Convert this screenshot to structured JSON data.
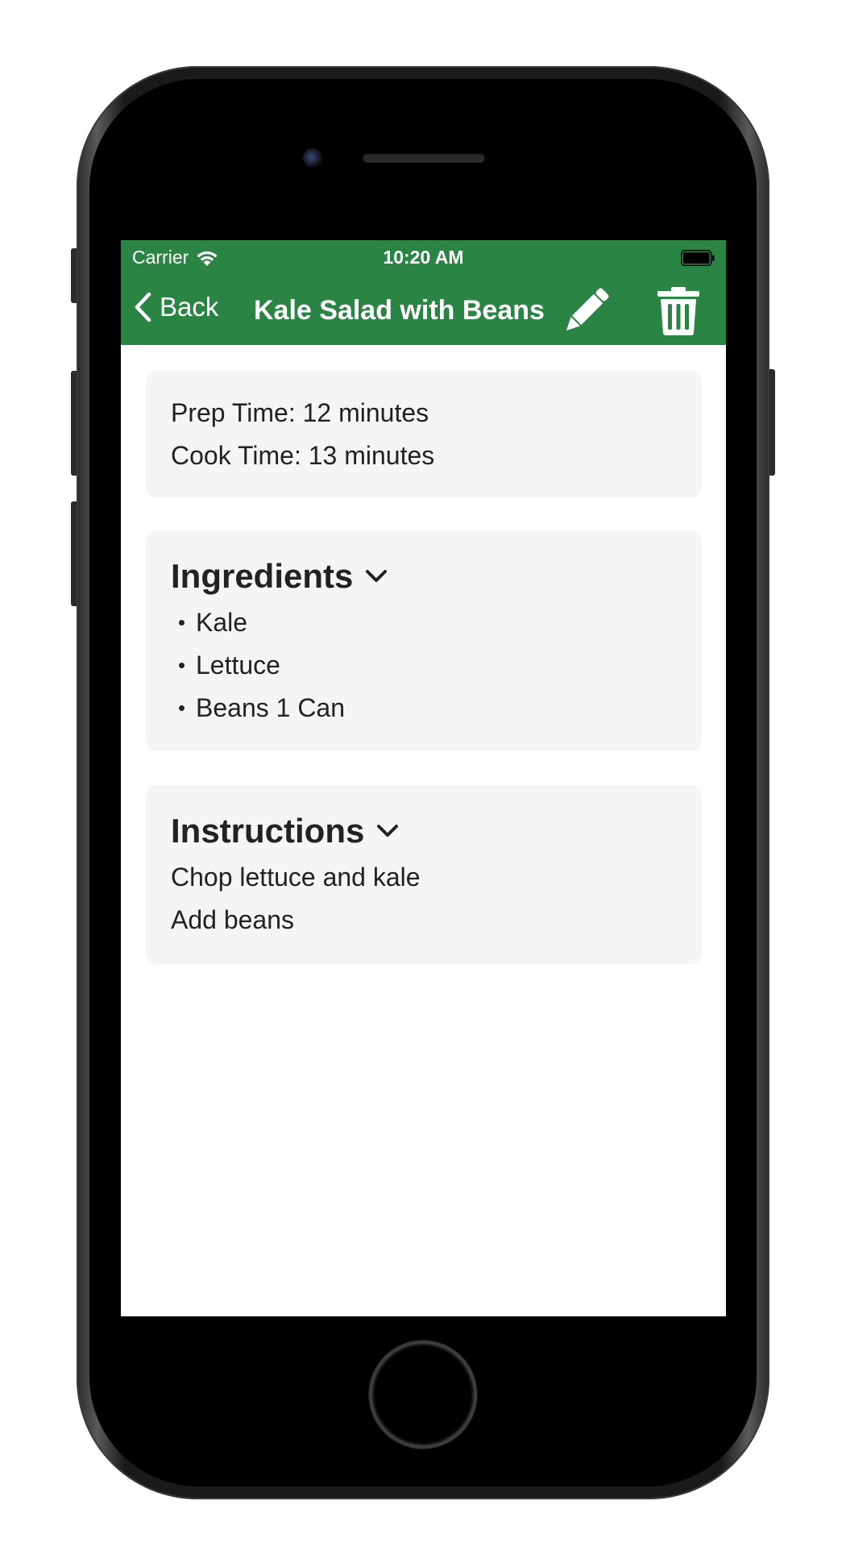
{
  "status_bar": {
    "carrier": "Carrier",
    "time": "10:20 AM",
    "wifi_icon": "wifi-icon",
    "battery_icon": "battery-icon"
  },
  "nav": {
    "back_label": "Back",
    "title": "Kale Salad with Beans",
    "edit_icon": "pencil-icon",
    "delete_icon": "trash-icon",
    "background_color": "#2a8544"
  },
  "times": {
    "prep": "Prep Time: 12 minutes",
    "cook": "Cook Time: 13 minutes"
  },
  "ingredients": {
    "title": "Ingredients",
    "items": [
      "Kale",
      "Lettuce",
      "Beans 1 Can"
    ]
  },
  "instructions": {
    "title": "Instructions",
    "steps": [
      "Chop lettuce and kale",
      "Add beans"
    ]
  },
  "colors": {
    "accent": "#2a8544",
    "card_bg": "#f5f5f5",
    "text": "#222222"
  }
}
